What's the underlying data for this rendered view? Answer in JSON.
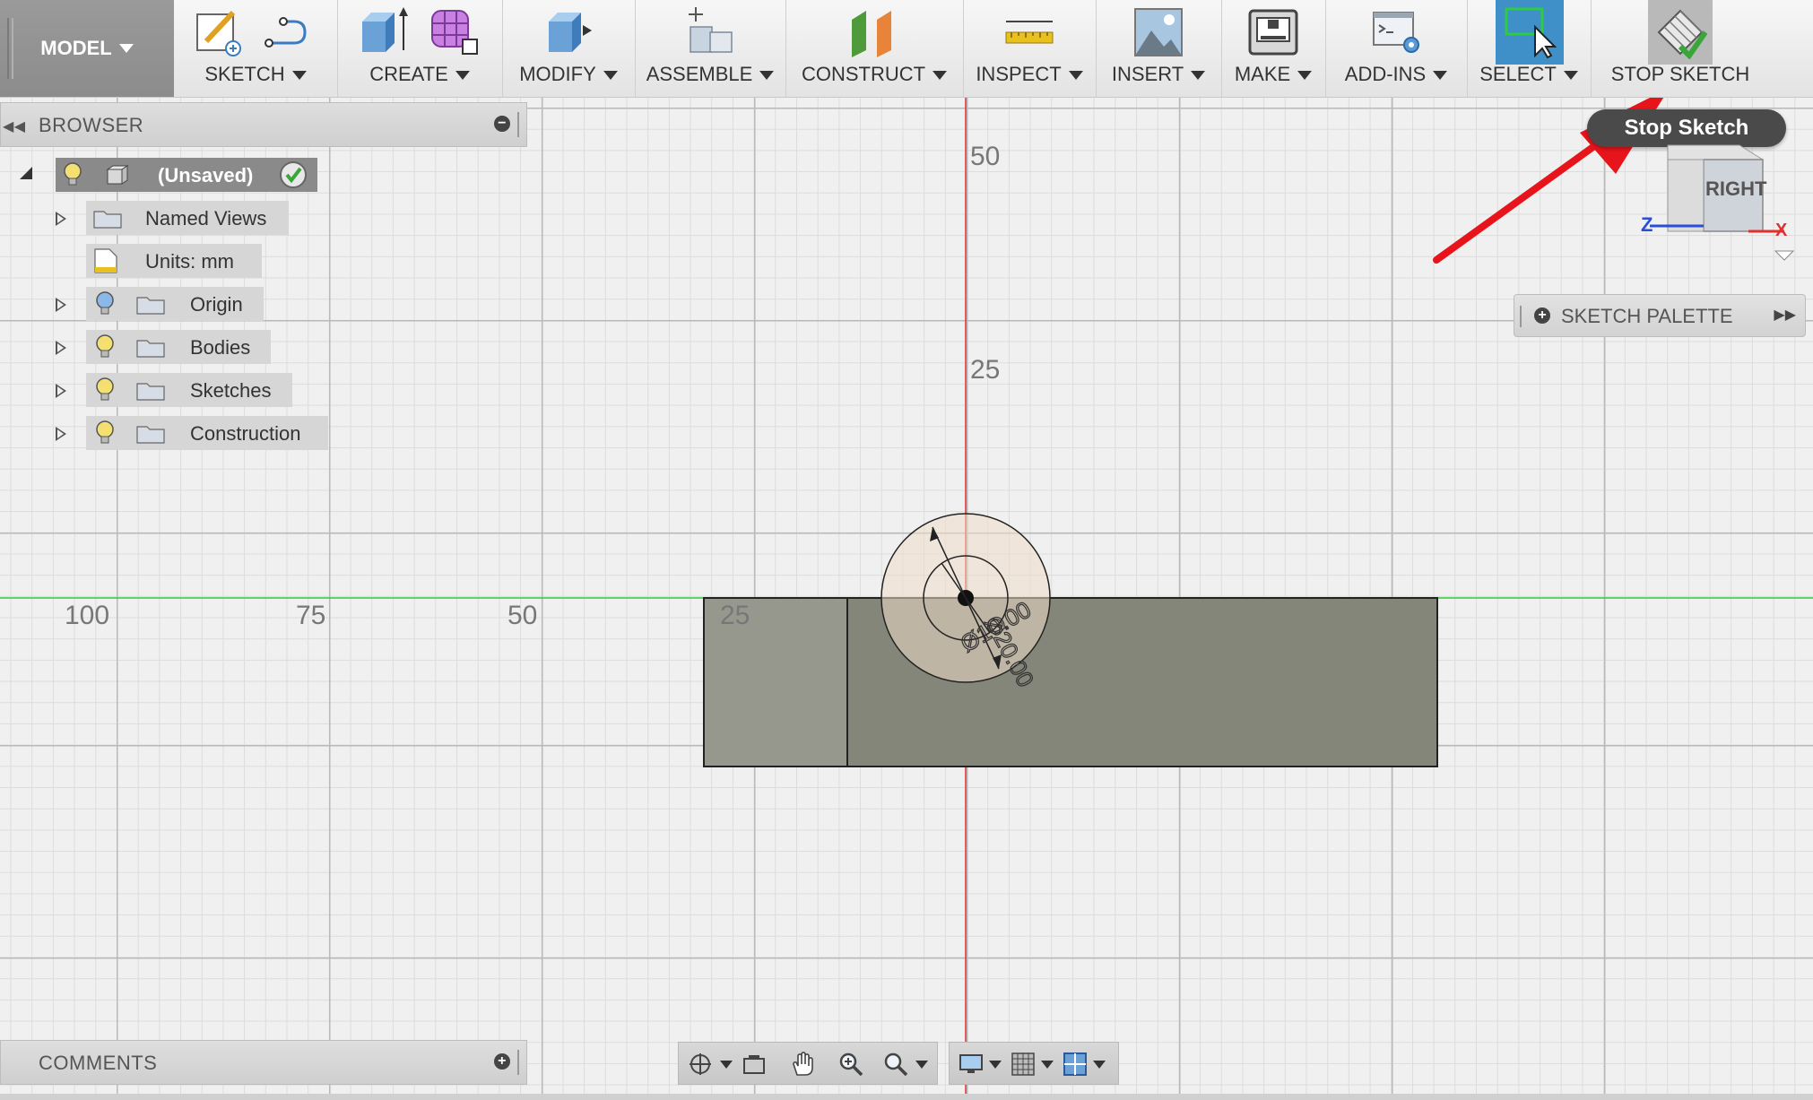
{
  "toolbar": {
    "workspace": "MODEL",
    "groups": [
      {
        "label": "SKETCH"
      },
      {
        "label": "CREATE"
      },
      {
        "label": "MODIFY"
      },
      {
        "label": "ASSEMBLE"
      },
      {
        "label": "CONSTRUCT"
      },
      {
        "label": "INSPECT"
      },
      {
        "label": "INSERT"
      },
      {
        "label": "MAKE"
      },
      {
        "label": "ADD-INS"
      },
      {
        "label": "SELECT"
      },
      {
        "label": "STOP SKETCH"
      }
    ]
  },
  "browser": {
    "title": "BROWSER",
    "root": "(Unsaved)",
    "items": [
      {
        "label": "Named Views"
      },
      {
        "label": "Units: mm"
      },
      {
        "label": "Origin"
      },
      {
        "label": "Bodies"
      },
      {
        "label": "Sketches"
      },
      {
        "label": "Construction"
      }
    ]
  },
  "comments": {
    "title": "COMMENTS"
  },
  "tooltip": {
    "text": "Stop Sketch"
  },
  "sketch_palette": {
    "title": "SKETCH PALETTE"
  },
  "viewcube": {
    "face": "RIGHT",
    "axis_z": "Z",
    "axis_x": "X"
  },
  "canvas": {
    "ruler_vertical": [
      "50",
      "25"
    ],
    "ruler_horizontal": [
      "100",
      "75",
      "50",
      "25"
    ],
    "dimensions": [
      "Ø20.00",
      "Ø10.00"
    ]
  },
  "colors": {
    "accent_select": "#3f8fc8",
    "arrow": "#e8141c",
    "x_axis": "#2ecc40",
    "y_axis": "#e03030"
  }
}
